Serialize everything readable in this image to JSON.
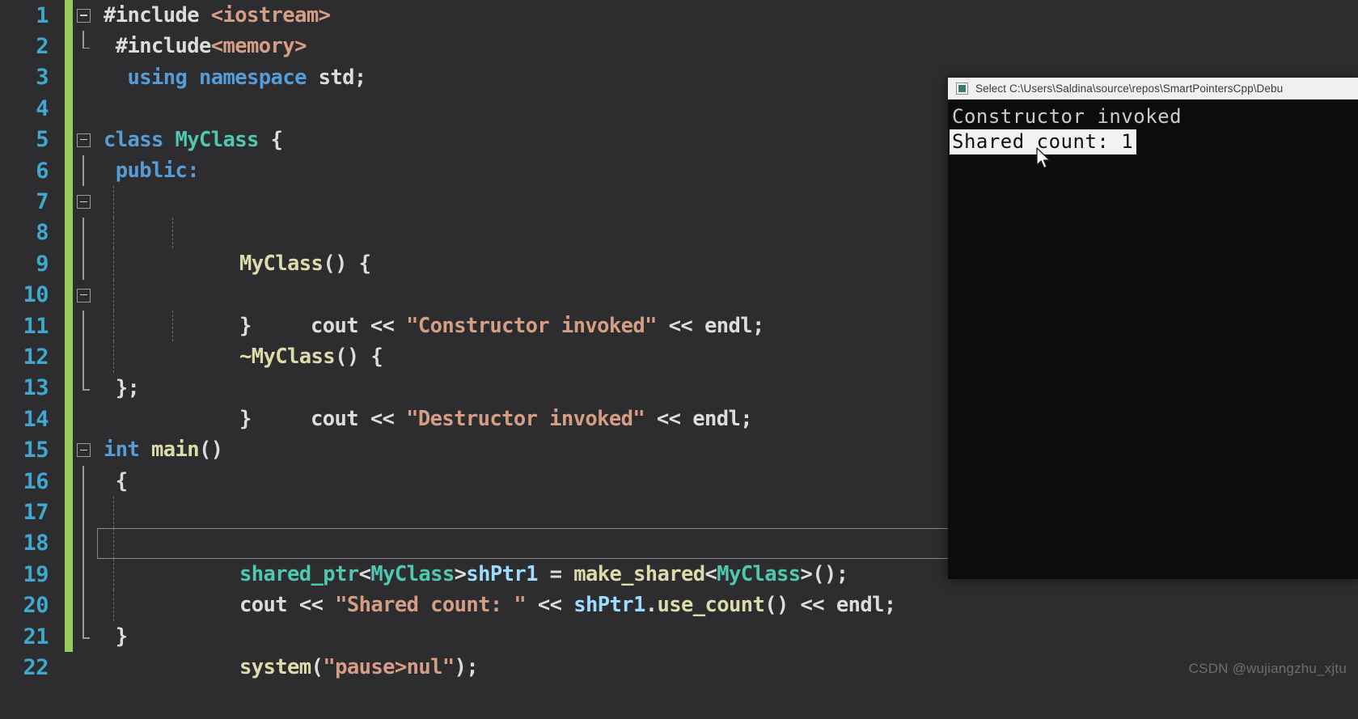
{
  "editor": {
    "name": "visual-studio-code-editor",
    "background_color": "#2d2d30",
    "line_number_color": "#3fa8ce",
    "changebar_saved_color": "#97cc5b",
    "current_line": 18,
    "lines": [
      {
        "num": "1",
        "text": "#include <iostream>"
      },
      {
        "num": "2",
        "text": " #include<memory>"
      },
      {
        "num": "3",
        "text": "  using namespace std;"
      },
      {
        "num": "4",
        "text": ""
      },
      {
        "num": "5",
        "text": "class MyClass {"
      },
      {
        "num": "6",
        "text": " public:"
      },
      {
        "num": "7",
        "text": "     MyClass() {"
      },
      {
        "num": "8",
        "text": "         cout << \"Constructor invoked\" << endl;"
      },
      {
        "num": "9",
        "text": "     }"
      },
      {
        "num": "10",
        "text": "     ~MyClass() {"
      },
      {
        "num": "11",
        "text": "         cout << \"Destructor invoked\" << endl;"
      },
      {
        "num": "12",
        "text": "     }"
      },
      {
        "num": "13",
        "text": " };"
      },
      {
        "num": "14",
        "text": ""
      },
      {
        "num": "15",
        "text": "int main()"
      },
      {
        "num": "16",
        "text": " {"
      },
      {
        "num": "17",
        "text": "     shared_ptr<MyClass>shPtr1 = make_shared<MyClass>();"
      },
      {
        "num": "18",
        "text": "     cout << \"Shared count: \" << shPtr1.use_count() << endl;"
      },
      {
        "num": "19",
        "text": ""
      },
      {
        "num": "20",
        "text": "     system(\"pause>nul\");"
      },
      {
        "num": "21",
        "text": " }"
      },
      {
        "num": "22",
        "text": ""
      }
    ],
    "tokens": {
      "include_1_directive": "#include",
      "include_1_header": "<iostream>",
      "include_2_directive": "#include",
      "include_2_header": "<memory>",
      "using_kw": "using",
      "namespace_kw": "namespace",
      "std_name": "std;",
      "class_kw": "class",
      "class_name": "MyClass",
      "class_open_brace": "{",
      "public_kw": "public:",
      "ctor_name": "MyClass",
      "ctor_sig": "() {",
      "cout_1": "cout",
      "shift_1": "<<",
      "str_constructor": "\"Constructor invoked\"",
      "shift_2": "<<",
      "endl_1": "endl;",
      "close_brace_9": "}",
      "dtor_name": "~MyClass",
      "dtor_sig": "() {",
      "cout_2": "cout",
      "shift_3": "<<",
      "str_destructor": "\"Destructor invoked\"",
      "shift_4": "<<",
      "endl_2": "endl;",
      "close_brace_12": "}",
      "class_end": "};",
      "int_kw": "int",
      "main_name": "main",
      "main_parens": "()",
      "main_open_brace": "{",
      "shared_ptr_type": "shared_ptr",
      "lt_1": "<",
      "myclass_tpl_1": "MyClass",
      "gt_1": ">",
      "shptr1_var": "shPtr1",
      "assign_op": "=",
      "make_shared_fn": "make_shared",
      "lt_2": "<",
      "myclass_tpl_2": "MyClass",
      "gt_2": ">",
      "call_end": "();",
      "cout_3": "cout",
      "shift_5": "<<",
      "str_shared_count": "\"Shared count: \"",
      "shift_6": "<<",
      "shptr1_ref": "shPtr1",
      "dot": ".",
      "use_count_fn": "use_count",
      "use_count_parens": "()",
      "shift_7": "<<",
      "endl_3": "endl;",
      "system_fn": "system",
      "lparen": "(",
      "str_pause": "\"pause>nul\"",
      "rparen_semi": ");",
      "main_close_brace": "}"
    }
  },
  "console": {
    "name": "windows-console-window",
    "title": "Select C:\\Users\\Saldina\\source\\repos\\SmartPointersCpp\\Debu",
    "background_color": "#0c0c0c",
    "titlebar_color": "#f0f0f0",
    "output_lines": [
      {
        "text": "Constructor invoked",
        "selected": false
      },
      {
        "text": "Shared count: 1",
        "selected": true
      }
    ]
  },
  "watermark": {
    "text": "CSDN @wujiangzhu_xjtu"
  }
}
